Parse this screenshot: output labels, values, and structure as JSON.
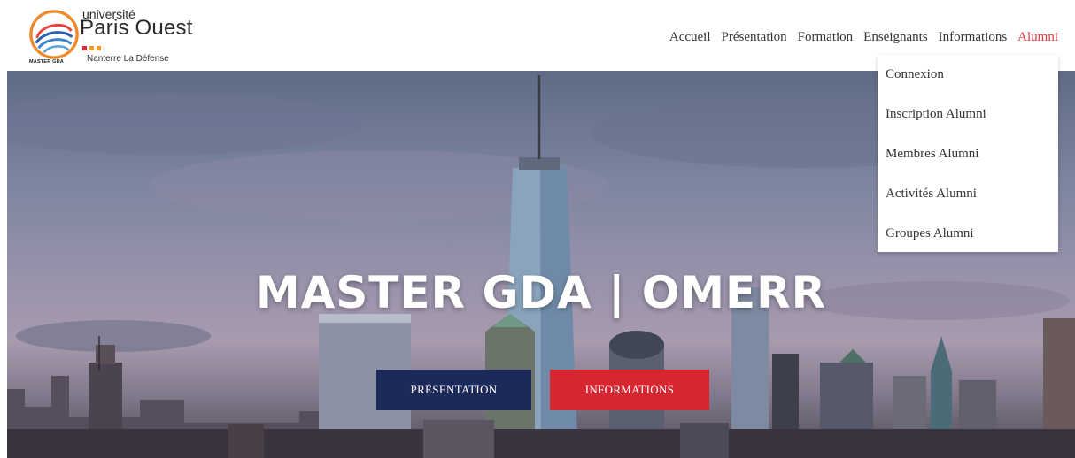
{
  "brand": {
    "university_line": "université",
    "name_line": "Paris Ouest",
    "campus_line": "Nanterre La Défense",
    "logo_caption": "MASTER GDA",
    "square_colors": [
      "#e5293a",
      "#f29b23",
      "#f29b23"
    ]
  },
  "nav": {
    "items": [
      {
        "label": "Accueil"
      },
      {
        "label": "Présentation"
      },
      {
        "label": "Formation"
      },
      {
        "label": "Enseignants"
      },
      {
        "label": "Informations"
      },
      {
        "label": "Alumni"
      }
    ],
    "active_index": 5
  },
  "dropdown": {
    "items": [
      {
        "label": "Connexion"
      },
      {
        "label": "Inscription Alumni"
      },
      {
        "label": "Membres Alumni"
      },
      {
        "label": "Activités Alumni"
      },
      {
        "label": "Groupes Alumni"
      }
    ]
  },
  "hero": {
    "title": "MASTER GDA | OMERR",
    "buttons": {
      "presentation": "PRÉSENTATION",
      "informations": "INFORMATIONS"
    }
  },
  "colors": {
    "accent_red": "#e0363f",
    "button_navy": "#1c2a5a",
    "button_red": "#d7262f"
  }
}
